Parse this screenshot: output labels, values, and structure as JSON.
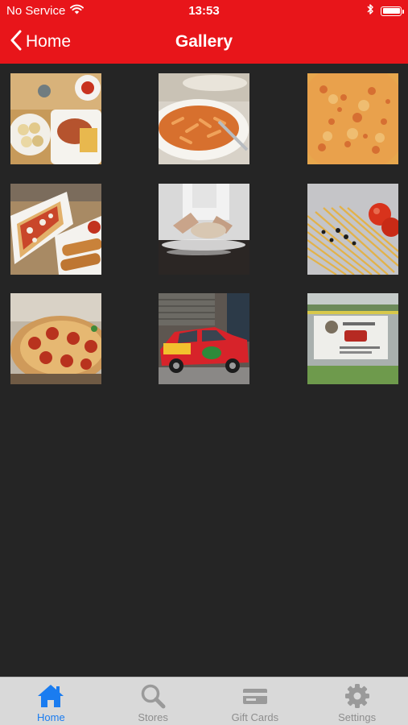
{
  "status_bar": {
    "carrier": "No Service",
    "time": "13:53"
  },
  "nav": {
    "back_label": "Home",
    "title": "Gallery"
  },
  "gallery": {
    "images": [
      {
        "name": "gallery-image-appetizers-platter",
        "subject": "appetizers platter"
      },
      {
        "name": "gallery-image-penne-pasta",
        "subject": "penne pasta"
      },
      {
        "name": "gallery-image-cheese-pizza",
        "subject": "cheese pizza"
      },
      {
        "name": "gallery-image-sub-and-breadsticks",
        "subject": "sub sandwich and breadsticks"
      },
      {
        "name": "gallery-image-dough-kneading",
        "subject": "dough kneading"
      },
      {
        "name": "gallery-image-spaghetti-tomatoes",
        "subject": "spaghetti and tomatoes"
      },
      {
        "name": "gallery-image-pepperoni-pizza",
        "subject": "pepperoni pizza"
      },
      {
        "name": "gallery-image-delivery-car",
        "subject": "delivery car"
      },
      {
        "name": "gallery-image-banner-sign",
        "subject": "banner sign"
      }
    ]
  },
  "tabbar": {
    "tabs": [
      {
        "label": "Home",
        "icon": "home-icon",
        "active": true
      },
      {
        "label": "Stores",
        "icon": "search-icon",
        "active": false
      },
      {
        "label": "Gift Cards",
        "icon": "gift-card-icon",
        "active": false
      },
      {
        "label": "Settings",
        "icon": "gear-icon",
        "active": false
      }
    ]
  },
  "colors": {
    "brand_red": "#e8151a",
    "tab_active": "#1a7cf0",
    "tab_inactive": "#8e8e8e",
    "background": "#252525"
  }
}
